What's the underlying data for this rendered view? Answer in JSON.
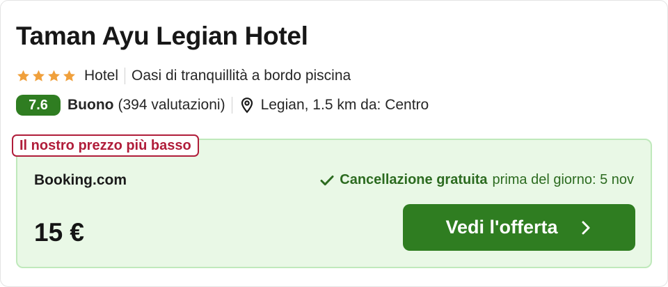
{
  "hotel": {
    "name": "Taman Ayu Legian Hotel",
    "star_count": 4,
    "type": "Hotel",
    "tagline": "Oasi di tranquillità a bordo piscina",
    "score": "7.6",
    "rating_word": "Buono",
    "reviews": "(394 valutazioni)",
    "location": "Legian, 1.5 km da: Centro"
  },
  "offer": {
    "badge": "Il nostro prezzo più basso",
    "provider": "Booking.com",
    "cancel_strong": "Cancellazione gratuita",
    "cancel_note": "prima del giorno: 5 nov",
    "price": "15 €",
    "cta_label": "Vedi l'offerta"
  },
  "colors": {
    "star": "#f0a03c",
    "score_bg": "#2f7d21",
    "badge": "#b01d3a",
    "offer_bg": "#e9f8e6",
    "cta_bg": "#2f7d21"
  },
  "icons": [
    "star-icon",
    "map-pin-icon",
    "check-icon",
    "chevron-right-icon"
  ]
}
